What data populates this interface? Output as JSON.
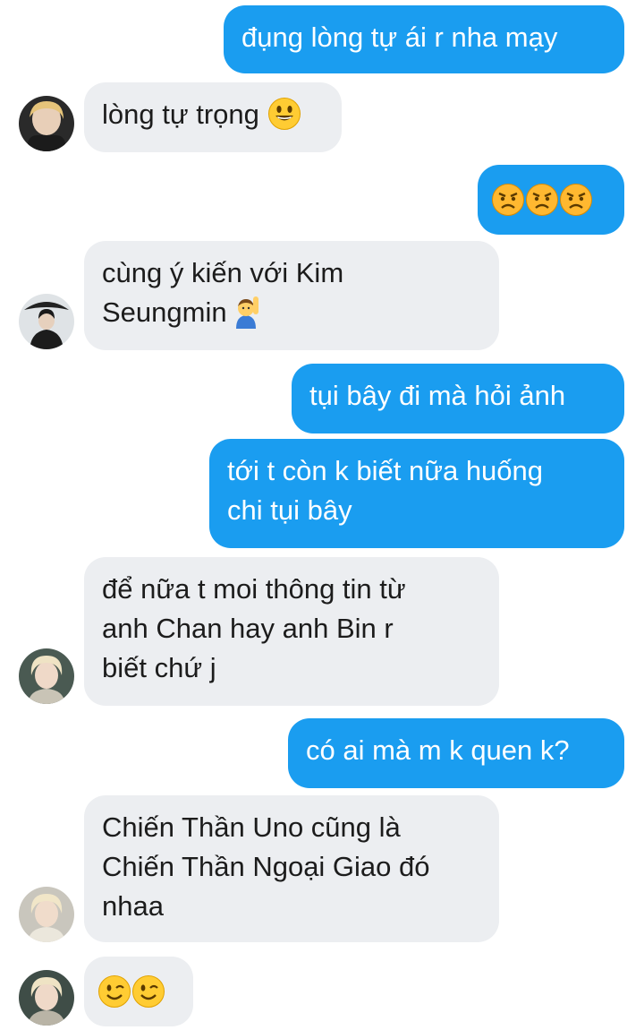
{
  "messages": [
    {
      "side": "sent",
      "text": "đụng lòng tự ái r nha mạy"
    },
    {
      "side": "recv",
      "text": "lòng tự trọng",
      "emoji": "grinning-face-emoji"
    },
    {
      "side": "sent",
      "text": "",
      "emoji": "angry-face-emoji x3"
    },
    {
      "side": "recv",
      "line1": "cùng ý kiến với Kim",
      "line2": "Seungmin",
      "emoji": "person-raising-hand-emoji"
    },
    {
      "side": "sent",
      "text": "tụi bây đi mà hỏi ảnh"
    },
    {
      "side": "sent",
      "line1": "tới t còn k biết nữa huống",
      "line2": "chi tụi bây"
    },
    {
      "side": "recv",
      "line1": "để nữa t moi thông tin từ",
      "line2": "anh Chan hay anh Bin r",
      "line3": "biết chứ j"
    },
    {
      "side": "sent",
      "text": "có ai mà m k quen k?"
    },
    {
      "side": "recv",
      "line1": "Chiến Thần Uno cũng là",
      "line2": "Chiến Thần Ngoại Giao đó",
      "line3": "nhaa"
    },
    {
      "side": "recv",
      "text": "",
      "emoji": "winking-face-emoji x2"
    }
  ],
  "colors": {
    "sent_bubble": "#1a9df0",
    "received_bubble": "#eceef1",
    "sent_text": "#ffffff",
    "received_text": "#1c1c1c"
  }
}
